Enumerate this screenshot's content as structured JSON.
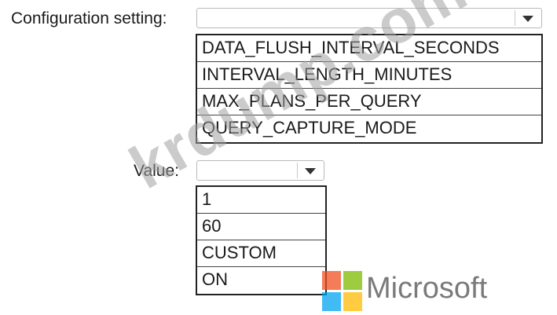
{
  "config": {
    "label": "Configuration setting:",
    "selected": "",
    "options": [
      "DATA_FLUSH_INTERVAL_SECONDS",
      "INTERVAL_LENGTH_MINUTES",
      "MAX_PLANS_PER_QUERY",
      "QUERY_CAPTURE_MODE"
    ]
  },
  "value": {
    "label": "Value:",
    "selected": "",
    "options": [
      "1",
      "60",
      "CUSTOM",
      "ON"
    ]
  },
  "watermark": "krdump.com",
  "brand": {
    "name": "Microsoft",
    "colors": [
      "#f25022",
      "#7fba00",
      "#00a4ef",
      "#ffb900"
    ]
  },
  "icons": {
    "dropdown": "chevron-down-icon"
  }
}
